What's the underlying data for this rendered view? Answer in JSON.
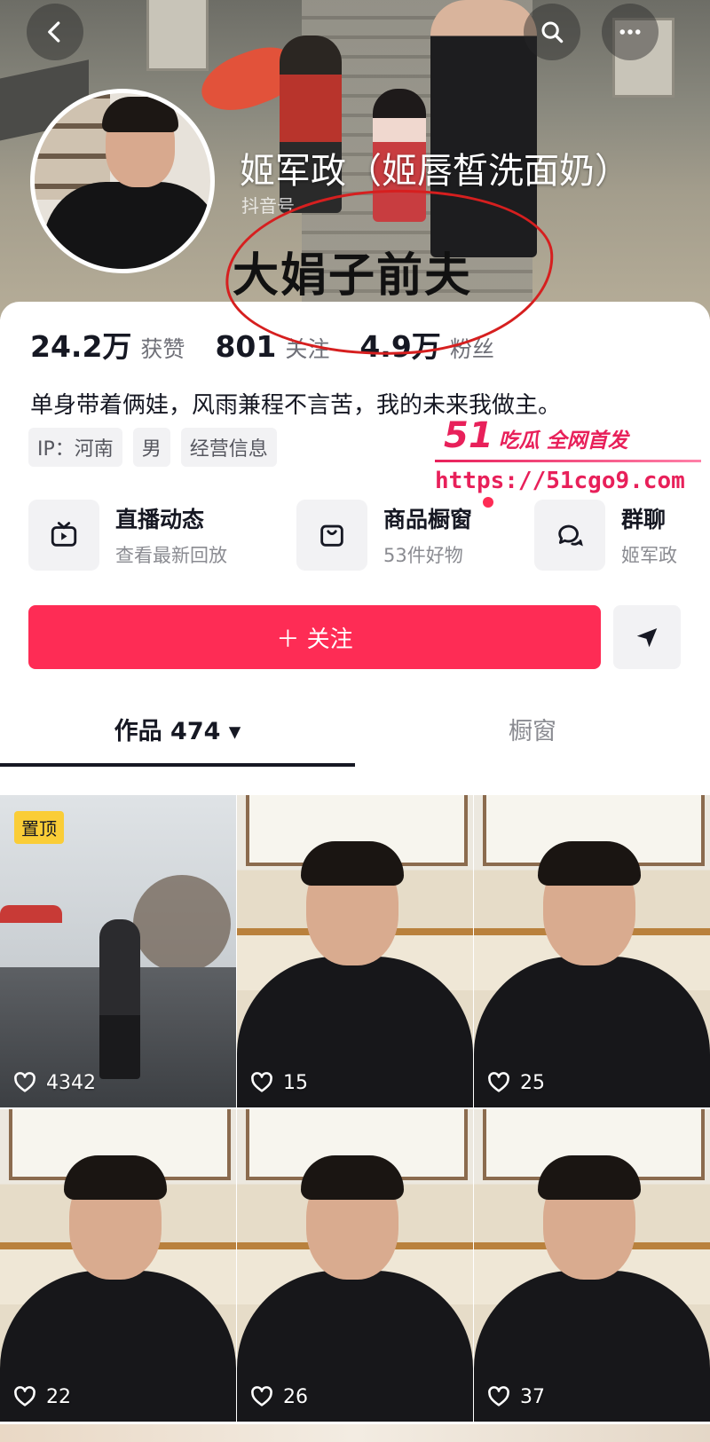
{
  "colors": {
    "accent": "#fe2c55",
    "text": "#161823",
    "muted": "#8a8b91",
    "pin": "#facd37",
    "annotation": "#d61f1f",
    "watermark": "#e8205a"
  },
  "header": {
    "back_icon": "chevron-left-icon",
    "search_icon": "search-icon",
    "more_icon": "more-icon"
  },
  "profile": {
    "name": "姬军政（姬唇皙洗面奶）",
    "douyin_id_label": "抖音号",
    "overlay_text": "大娟子前夫",
    "stats": [
      {
        "value": "24.2万",
        "label": "获赞"
      },
      {
        "value": "801",
        "label": "关注"
      },
      {
        "value": "4.9万",
        "label": "粉丝"
      }
    ],
    "bio": "单身带着俩娃，风雨兼程不言苦，我的未来我做主。",
    "tags": [
      "IP：河南",
      "男",
      "经营信息"
    ]
  },
  "watermark": {
    "brand_number": "51",
    "brand_text": "吃瓜 全网首发",
    "url": "https://51cgo9.com"
  },
  "features": [
    {
      "icon": "tv-icon",
      "title": "直播动态",
      "subtitle": "查看最新回放"
    },
    {
      "icon": "shopping-bag-icon",
      "title": "商品橱窗",
      "subtitle": "53件好物"
    },
    {
      "icon": "chat-icon",
      "title": "群聊",
      "subtitle": "姬军政"
    }
  ],
  "actions": {
    "follow_label": "＋ 关注",
    "share_icon": "send-icon"
  },
  "tabs": {
    "works_label": "作品 474 ▾",
    "showcase_label": "橱窗"
  },
  "grid": {
    "pin_label": "置顶",
    "items": [
      {
        "likes": "4342"
      },
      {
        "likes": "15"
      },
      {
        "likes": "25"
      },
      {
        "likes": "22"
      },
      {
        "likes": "26"
      },
      {
        "likes": "37"
      }
    ]
  }
}
